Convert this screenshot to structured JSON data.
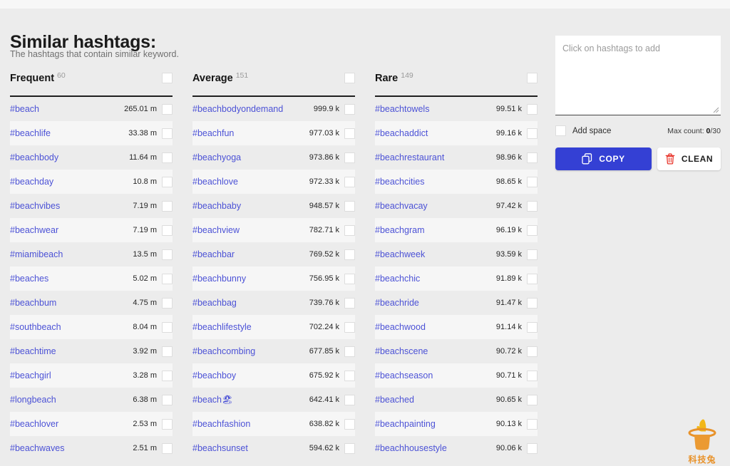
{
  "header": {
    "title": "Similar hashtags:",
    "subtitle": "The hashtags that contain similar keyword."
  },
  "columns": [
    {
      "name": "Frequent",
      "count": "60",
      "rows": [
        {
          "tag": "#beach",
          "count": "265.01 m"
        },
        {
          "tag": "#beachlife",
          "count": "33.38 m"
        },
        {
          "tag": "#beachbody",
          "count": "11.64 m"
        },
        {
          "tag": "#beachday",
          "count": "10.8 m"
        },
        {
          "tag": "#beachvibes",
          "count": "7.19 m"
        },
        {
          "tag": "#beachwear",
          "count": "7.19 m"
        },
        {
          "tag": "#miamibeach",
          "count": "13.5 m"
        },
        {
          "tag": "#beaches",
          "count": "5.02 m"
        },
        {
          "tag": "#beachbum",
          "count": "4.75 m"
        },
        {
          "tag": "#southbeach",
          "count": "8.04 m"
        },
        {
          "tag": "#beachtime",
          "count": "3.92 m"
        },
        {
          "tag": "#beachgirl",
          "count": "3.28 m"
        },
        {
          "tag": "#longbeach",
          "count": "6.38 m"
        },
        {
          "tag": "#beachlover",
          "count": "2.53 m"
        },
        {
          "tag": "#beachwaves",
          "count": "2.51 m"
        }
      ]
    },
    {
      "name": "Average",
      "count": "151",
      "rows": [
        {
          "tag": "#beachbodyondemand",
          "count": "999.9 k"
        },
        {
          "tag": "#beachfun",
          "count": "977.03 k"
        },
        {
          "tag": "#beachyoga",
          "count": "973.86 k"
        },
        {
          "tag": "#beachlove",
          "count": "972.33 k"
        },
        {
          "tag": "#beachbaby",
          "count": "948.57 k"
        },
        {
          "tag": "#beachview",
          "count": "782.71 k"
        },
        {
          "tag": "#beachbar",
          "count": "769.52 k"
        },
        {
          "tag": "#beachbunny",
          "count": "756.95 k"
        },
        {
          "tag": "#beachbag",
          "count": "739.76 k"
        },
        {
          "tag": "#beachlifestyle",
          "count": "702.24 k"
        },
        {
          "tag": "#beachcombing",
          "count": "677.85 k"
        },
        {
          "tag": "#beachboy",
          "count": "675.92 k"
        },
        {
          "tag": "#beach🏖",
          "count": "642.41 k"
        },
        {
          "tag": "#beachfashion",
          "count": "638.82 k"
        },
        {
          "tag": "#beachsunset",
          "count": "594.62 k"
        }
      ]
    },
    {
      "name": "Rare",
      "count": "149",
      "rows": [
        {
          "tag": "#beachtowels",
          "count": "99.51 k"
        },
        {
          "tag": "#beachaddict",
          "count": "99.16 k"
        },
        {
          "tag": "#beachrestaurant",
          "count": "98.96 k"
        },
        {
          "tag": "#beachcities",
          "count": "98.65 k"
        },
        {
          "tag": "#beachvacay",
          "count": "97.42 k"
        },
        {
          "tag": "#beachgram",
          "count": "96.19 k"
        },
        {
          "tag": "#beachweek",
          "count": "93.59 k"
        },
        {
          "tag": "#beachchic",
          "count": "91.89 k"
        },
        {
          "tag": "#beachride",
          "count": "91.47 k"
        },
        {
          "tag": "#beachwood",
          "count": "91.14 k"
        },
        {
          "tag": "#beachscene",
          "count": "90.72 k"
        },
        {
          "tag": "#beachseason",
          "count": "90.71 k"
        },
        {
          "tag": "#beached",
          "count": "90.65 k"
        },
        {
          "tag": "#beachpainting",
          "count": "90.13 k"
        },
        {
          "tag": "#beachhousestyle",
          "count": "90.06 k"
        }
      ]
    }
  ],
  "panel": {
    "textarea_placeholder": "Click on hashtags to add",
    "textarea_value": "",
    "add_space_label": "Add space",
    "max_count_label": "Max count: ",
    "max_count_current": "0",
    "max_count_total": "/30",
    "copy_label": "COPY",
    "clean_label": "CLEAN"
  },
  "watermark": {
    "text": "科技兔"
  },
  "colors": {
    "accent": "#3440d4",
    "link": "#4c52d6",
    "danger": "#e8342a",
    "page_bg": "#ececec",
    "row_alt_bg": "#f6f6f6",
    "watermark": "#e8922a"
  }
}
